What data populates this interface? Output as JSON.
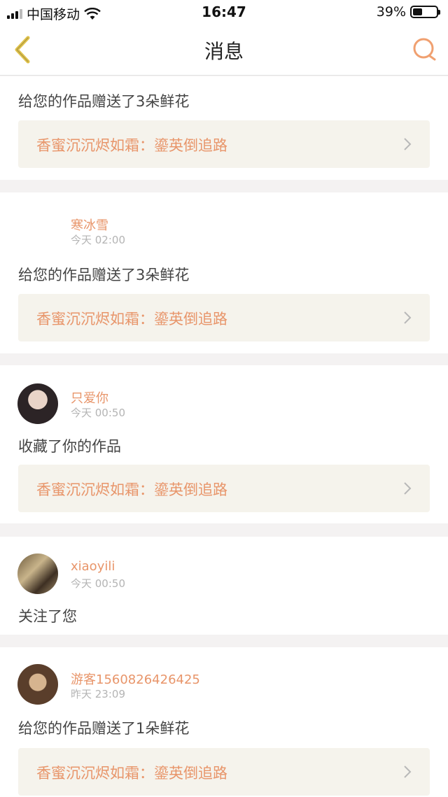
{
  "status_bar": {
    "carrier": "中国移动",
    "time": "16:47",
    "battery": "39%",
    "battery_level": 0.39
  },
  "nav": {
    "title": "消息",
    "back_icon": "chevron-left-icon",
    "search_icon": "search-icon"
  },
  "colors": {
    "accent": "#e8956a",
    "back_icon": "#e0c24a",
    "link_bg": "#f5f3ec",
    "separator": "#f4f2f2"
  },
  "messages": [
    {
      "action": "给您的作品赠送了3朵鲜花",
      "work": "香蜜沉沉烬如霜：鎏英倒追路"
    },
    {
      "user": "寒冰雪",
      "time": "今天 02:00",
      "action": "给您的作品赠送了3朵鲜花",
      "work": "香蜜沉沉烬如霜：鎏英倒追路"
    },
    {
      "user": "只爱你",
      "time": "今天 00:50",
      "action": "收藏了你的作品",
      "work": "香蜜沉沉烬如霜：鎏英倒追路"
    },
    {
      "user": "xiaoyili",
      "time": "今天 00:50",
      "action": "关注了您"
    },
    {
      "user": "游客1560826426425",
      "time": "昨天 23:09",
      "action": "给您的作品赠送了1朵鲜花",
      "work": "香蜜沉沉烬如霜：鎏英倒追路"
    }
  ]
}
